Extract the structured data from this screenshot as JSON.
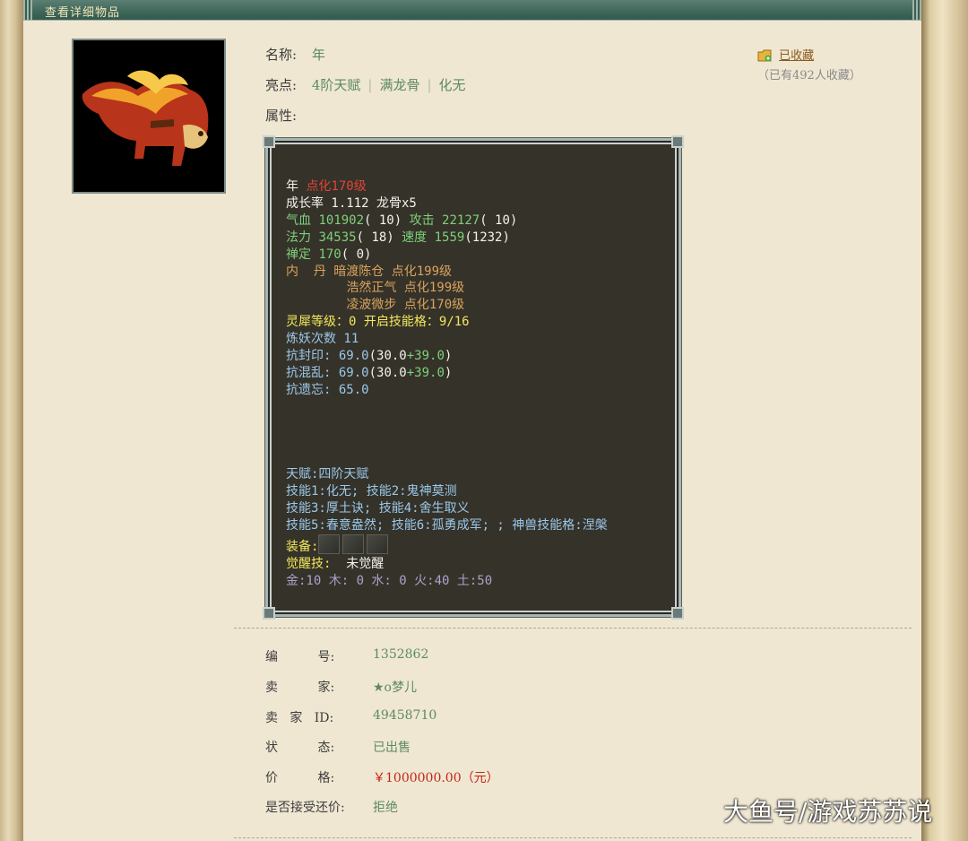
{
  "window": {
    "title": "查看详细物品"
  },
  "favorite": {
    "label": "已收藏",
    "count_text": "（已有492人收藏）"
  },
  "item": {
    "name_label": "名称:",
    "name": "年",
    "highlights_label": "亮点:",
    "highlights": [
      "4阶天赋",
      "满龙骨",
      "化无"
    ],
    "attributes_label": "属性:"
  },
  "panel": {
    "pet_name": "年",
    "pet_level": "点化170级",
    "growth": "成长率 1.112 龙骨x5",
    "hp_label": "气血",
    "hp": "101902",
    "hp_pts": "( 10)",
    "atk_label": "攻击",
    "atk": "22127",
    "atk_pts": "( 10)",
    "mp_label": "法力",
    "mp": "34535",
    "mp_pts": "( 18)",
    "spd_label": "速度",
    "spd": "1559",
    "spd_pts": "(1232)",
    "zen_label": "禅定",
    "zen": "170",
    "zen_pts": "( 0)",
    "neidan_label": "内  丹",
    "neidan": [
      "暗渡陈仓 点化199级",
      "浩然正气 点化199级",
      "凌波微步 点化170级"
    ],
    "lingxi": "灵犀等级：0 开启技能格：9/16",
    "lianyao": "炼妖次数 11",
    "resist_seal_label": "抗封印:",
    "resist_seal": "69.0",
    "resist_seal_base": "(30.0",
    "resist_seal_bonus": "+39.0",
    "resist_seal_close": ")",
    "resist_chaos_label": "抗混乱:",
    "resist_chaos": "69.0",
    "resist_chaos_base": "(30.0",
    "resist_chaos_bonus": "+39.0",
    "resist_chaos_close": ")",
    "resist_forget_label": "抗遗忘:",
    "resist_forget": "65.0",
    "talent": "天赋:四阶天赋",
    "skills_1": "技能1:化无; 技能2:鬼神莫测",
    "skills_2": "技能3:厚土诀; 技能4:舍生取义",
    "skills_3": "技能5:春意盎然; 技能6:孤勇成军; ; 神兽技能格:涅槃",
    "equip_label": "装备:",
    "awaken_label": "觉醒技:",
    "awaken": "未觉醒",
    "elements": "金:10 木: 0 水: 0 火:40 土:50"
  },
  "info": [
    {
      "key": "编          号:",
      "value": "1352862"
    },
    {
      "key": "卖          家:",
      "value": "★o梦儿"
    },
    {
      "key": "卖   家   ID:",
      "value": "49458710"
    },
    {
      "key": "状          态:",
      "value": "已出售"
    },
    {
      "key": "价          格:",
      "value": "￥1000000.00（元）"
    },
    {
      "key": "是否接受还价:",
      "value": "拒绝"
    }
  ],
  "watermark": "大鱼号/游戏苏苏说",
  "colors": {
    "title_bar": "#3e6659",
    "panel_bg": "#353229",
    "price_red": "#c62418",
    "value_green": "#5d8a63"
  }
}
